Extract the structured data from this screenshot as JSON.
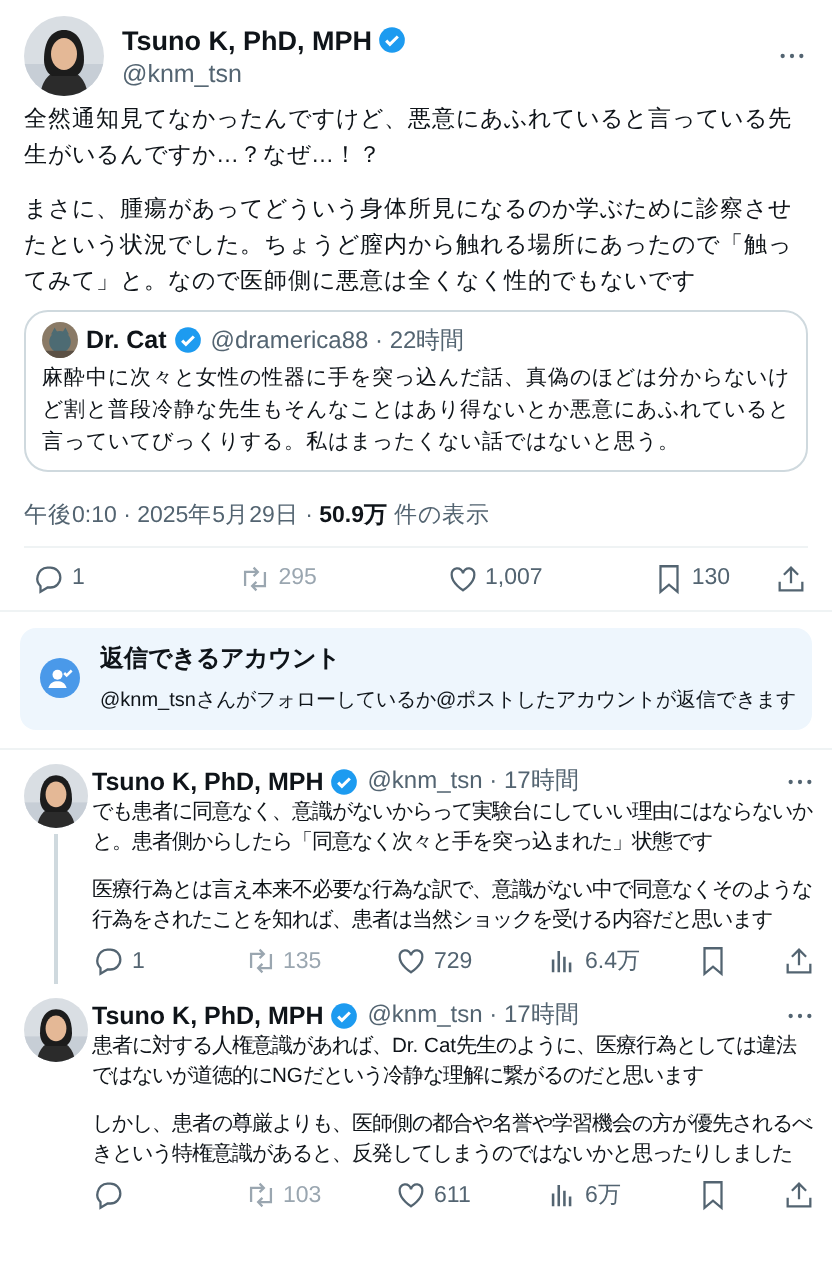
{
  "main_post": {
    "author": "Tsuno K, PhD, MPH",
    "verified": true,
    "handle": "@knm_tsn",
    "paragraphs": [
      "全然通知見てなかったんですけど、悪意にあふれていると言っている先生がいるんですか…？なぜ…！？",
      "まさに、腫瘍があってどういう身体所見になるのか学ぶために診察させたという状況でした。ちょうど膣内から触れる場所にあったので「触ってみて」と。なので医師側に悪意は全くなく性的でもないです"
    ],
    "quote": {
      "author": "Dr. Cat",
      "verified": true,
      "handle_time": "@dramerica88 · 22時間",
      "text": "麻酔中に次々と女性の性器に手を突っ込んだ話、真偽のほどは分からないけど割と普段冷静な先生もそんなことはあり得ないとか悪意にあふれていると言っていてびっくりする。私はまったくない話ではないと思う。"
    },
    "meta": "午後0:10 · 2025年5月29日 · **50.9万** 件の表示",
    "actions": [
      {
        "kind": "reply",
        "count": "1"
      },
      {
        "kind": "repost",
        "count": "295"
      },
      {
        "kind": "like",
        "count": "1,007"
      },
      {
        "kind": "bookmark",
        "count": "130"
      },
      {
        "kind": "share"
      }
    ]
  },
  "reply_notice": {
    "title": "返信できるアカウント",
    "text": "@knm_tsnさんがフォローしているか@ポストしたアカウントが返信できます"
  },
  "replies": [
    {
      "author": "Tsuno K, PhD, MPH",
      "verified": true,
      "handle_time": "@knm_tsn · 17時間",
      "thread_line": true,
      "paragraphs": [
        "でも患者に同意なく、意識がないからって実験台にしていい理由にはならないかと。患者側からしたら「同意なく次々と手を突っ込まれた」状態です",
        "医療行為とは言え本来不必要な行為な訳で、意識がない中で同意なくそのような行為をされたことを知れば、患者は当然ショックを受ける内容だと思います"
      ],
      "actions": [
        {
          "kind": "reply",
          "count": "1"
        },
        {
          "kind": "repost",
          "count": "135"
        },
        {
          "kind": "like",
          "count": "729"
        },
        {
          "kind": "views",
          "count": "6.4万"
        },
        {
          "kind": "bookmark"
        },
        {
          "kind": "share"
        }
      ]
    },
    {
      "author": "Tsuno K, PhD, MPH",
      "verified": true,
      "handle_time": "@knm_tsn · 17時間",
      "thread_line": false,
      "paragraphs": [
        "患者に対する人権意識があれば、Dr. Cat先生のように、医療行為としては違法ではないが道徳的にNGだという冷静な理解に繋がるのだと思います",
        "しかし、患者の尊厳よりも、医師側の都合や名誉や学習機会の方が優先されるべきという特権意識があると、反発してしまうのではないかと思ったりしました"
      ],
      "actions": [
        {
          "kind": "reply"
        },
        {
          "kind": "repost",
          "count": "103"
        },
        {
          "kind": "like",
          "count": "611"
        },
        {
          "kind": "views",
          "count": "6万"
        },
        {
          "kind": "bookmark"
        },
        {
          "kind": "share"
        }
      ]
    }
  ]
}
